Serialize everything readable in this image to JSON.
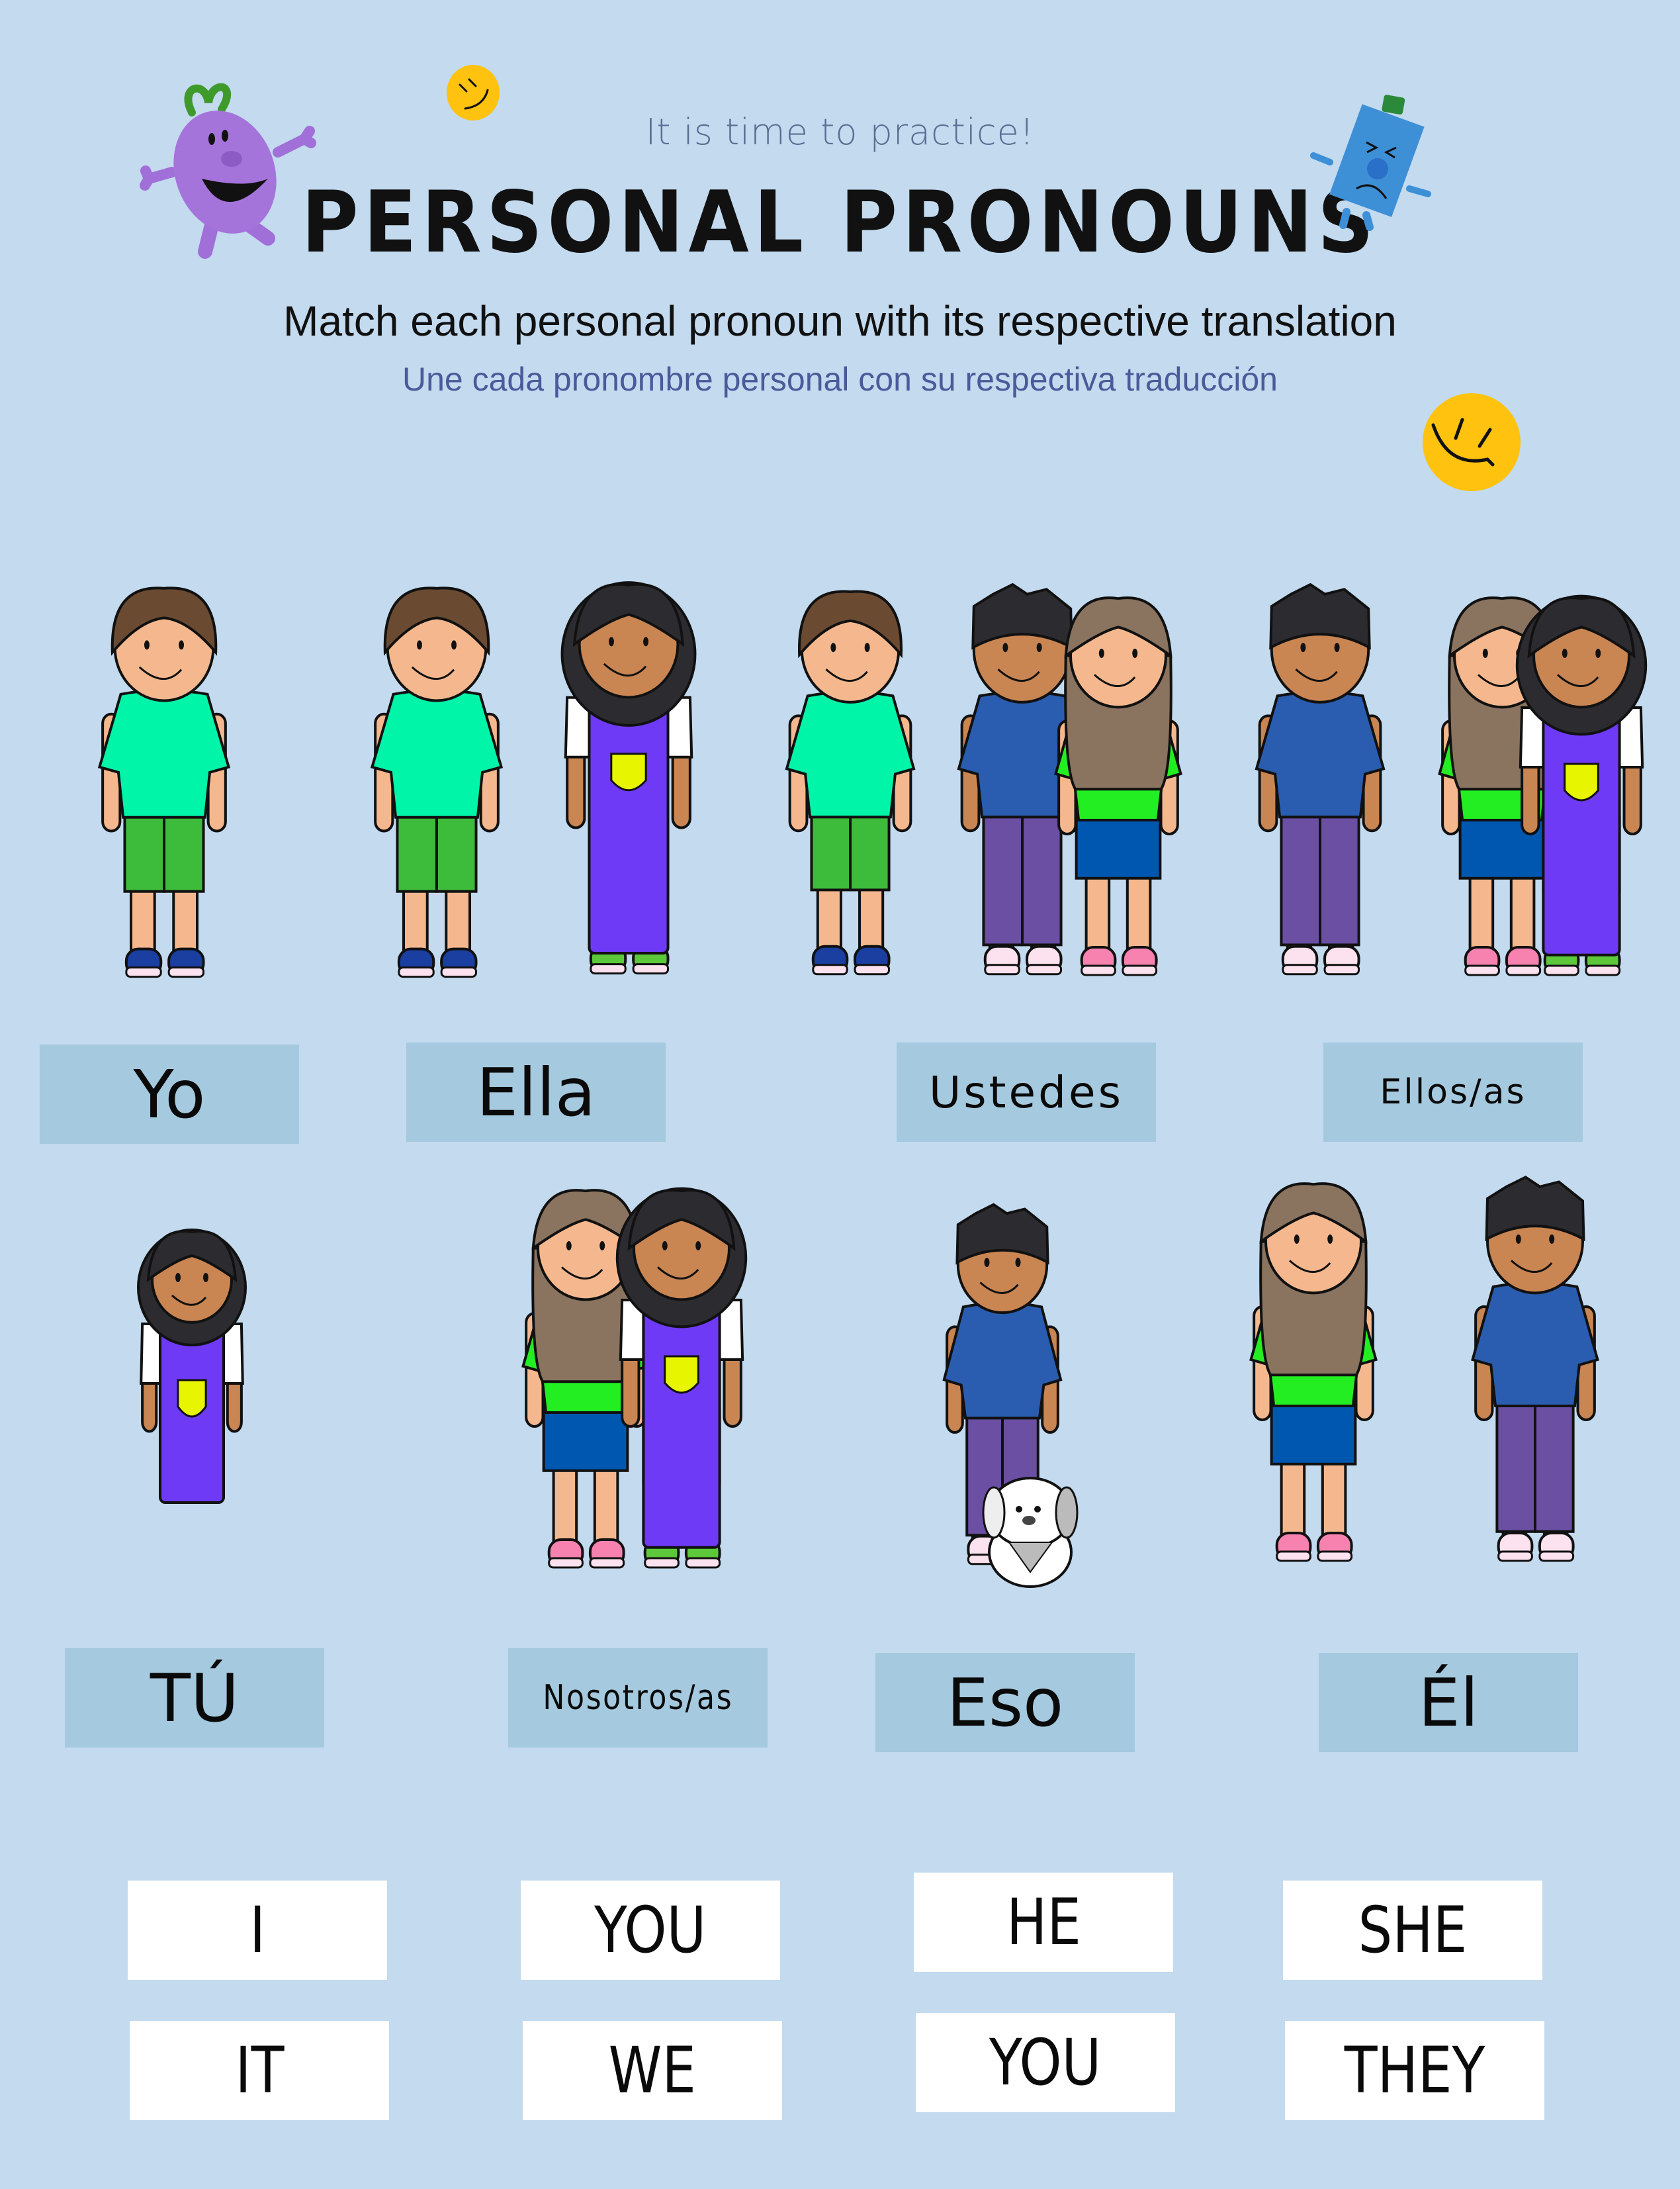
{
  "header": {
    "kicker": "It is time to practice!",
    "title": "PERSONAL PRONOUNS",
    "instruction_en": "Match each personal pronoun with its respective translation",
    "instruction_es": "Une cada pronombre personal con su respectiva traducción"
  },
  "decorations": [
    {
      "icon": "purple-character-icon",
      "description": "happy purple round character with green bow"
    },
    {
      "icon": "smiley-face-icon",
      "color": "#FFC20E"
    },
    {
      "icon": "blue-character-icon",
      "description": "sad blue rectangular character with green hat"
    },
    {
      "icon": "smiley-face-icon",
      "color": "#FFC20E"
    }
  ],
  "spanish_pronouns": {
    "row1": [
      {
        "label": "Yo",
        "illustration": "boy pointing at himself"
      },
      {
        "label": "Ella",
        "illustration": "boy pointing at a girl"
      },
      {
        "label": "Ustedes",
        "illustration": "boy pointing at a boy and a girl"
      },
      {
        "label": "Ellos/as",
        "illustration": "boy pointing at two girls"
      }
    ],
    "row2": [
      {
        "label": "TÚ",
        "illustration": "girl pointing at the viewer"
      },
      {
        "label": "Nosotros/as",
        "illustration": "two girls pointing at themselves"
      },
      {
        "label": "Eso",
        "illustration": "boy pointing at a dog"
      },
      {
        "label": "Él",
        "illustration": "girl pointing at a boy"
      }
    ]
  },
  "english_pronouns": {
    "row1": [
      "I",
      "YOU",
      "HE",
      "SHE"
    ],
    "row2": [
      "IT",
      "WE",
      "YOU",
      "THEY"
    ]
  },
  "colors": {
    "background": "#C3DAEF",
    "label_box": "#A5C9DE",
    "answer_box": "#FFFFFF",
    "kicker_text": "#5A6E94",
    "spanish_instruction_text": "#4A5A9A",
    "smiley": "#FFC20E"
  }
}
